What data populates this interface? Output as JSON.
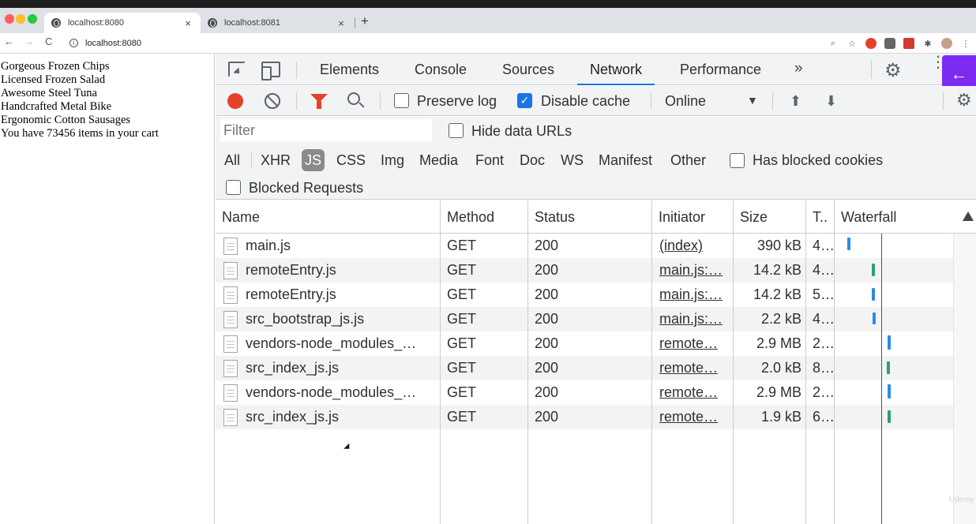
{
  "browser": {
    "tabs": [
      {
        "title": "localhost:8080",
        "close": "×"
      },
      {
        "title": "localhost:8081",
        "close": "×"
      }
    ],
    "new_tab": "+",
    "url": "localhost:8080",
    "nav": {
      "back": "←",
      "forward": "→",
      "reload": "C"
    }
  },
  "page": {
    "items": [
      "Gorgeous Frozen Chips",
      "Licensed Frozen Salad",
      "Awesome Steel Tuna",
      "Handcrafted Metal Bike",
      "Ergonomic Cotton Sausages",
      "You have 73456 items in your cart"
    ]
  },
  "devtools": {
    "tabs": [
      "Elements",
      "Console",
      "Sources",
      "Network",
      "Performance"
    ],
    "active_tab": "Network",
    "more_tabs": "»",
    "toolbar": {
      "preserve_log": "Preserve log",
      "disable_cache": "Disable cache",
      "throttling": "Online"
    },
    "filter": {
      "placeholder": "Filter",
      "hide_data_urls": "Hide data URLs",
      "types": [
        "All",
        "XHR",
        "JS",
        "CSS",
        "Img",
        "Media",
        "Font",
        "Doc",
        "WS",
        "Manifest",
        "Other"
      ],
      "active_type": "JS",
      "has_blocked_cookies": "Has blocked cookies",
      "blocked_requests": "Blocked Requests"
    },
    "table": {
      "headers": [
        "Name",
        "Method",
        "Status",
        "Initiator",
        "Size",
        "T..",
        "Waterfall"
      ],
      "rows": [
        {
          "name": "main.js",
          "method": "GET",
          "status": "200",
          "initiator": "(index)",
          "size": "390 kB",
          "time": "4…"
        },
        {
          "name": "remoteEntry.js",
          "method": "GET",
          "status": "200",
          "initiator": "main.js:…",
          "size": "14.2 kB",
          "time": "4…"
        },
        {
          "name": "remoteEntry.js",
          "method": "GET",
          "status": "200",
          "initiator": "main.js:…",
          "size": "14.2 kB",
          "time": "5…"
        },
        {
          "name": "src_bootstrap_js.js",
          "method": "GET",
          "status": "200",
          "initiator": "main.js:…",
          "size": "2.2 kB",
          "time": "4…"
        },
        {
          "name": "vendors-node_modules_…",
          "method": "GET",
          "status": "200",
          "initiator": "remote…",
          "size": "2.9 MB",
          "time": "2…"
        },
        {
          "name": "src_index_js.js",
          "method": "GET",
          "status": "200",
          "initiator": "remote…",
          "size": "2.0 kB",
          "time": "8…"
        },
        {
          "name": "vendors-node_modules_…",
          "method": "GET",
          "status": "200",
          "initiator": "remote…",
          "size": "2.9 MB",
          "time": "2…"
        },
        {
          "name": "src_index_js.js",
          "method": "GET",
          "status": "200",
          "initiator": "remote…",
          "size": "1.9 kB",
          "time": "6…"
        }
      ]
    }
  },
  "colors": {
    "accent": "#1a73e8",
    "record": "#e5402a",
    "waterfall_bar": "#2b8be8",
    "waterfall_green": "#28a36b",
    "side_button": "#7b2bf0"
  }
}
